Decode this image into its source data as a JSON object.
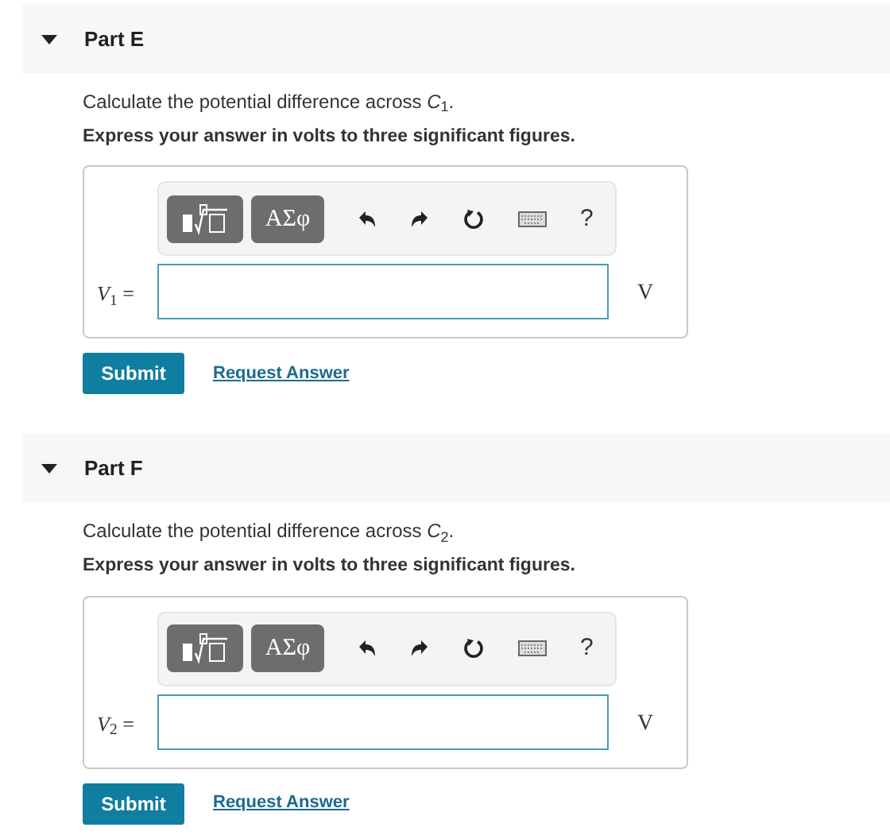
{
  "parts": [
    {
      "title": "Part E",
      "expanded": true,
      "prompt": "Calculate the potential difference across *C*$_{1}$.",
      "instruction": "Express your answer in volts to three significant figures.",
      "toolbar": {
        "templates": "ΑΣφ",
        "help": "?"
      },
      "answer": {
        "label": "*V*$_{1}$ =",
        "unit": "V"
      },
      "submit": "Submit",
      "request": "Request Answer"
    },
    {
      "title": "Part F",
      "expanded": true,
      "prompt": "Calculate the potential difference across *C*$_{2}$.",
      "instruction": "Express your answer in volts to three significant figures.",
      "toolbar": {
        "templates": "ΑΣφ",
        "help": "?"
      },
      "answer": {
        "label": "*V*$_{2}$ =",
        "unit": "V"
      },
      "submit": "Submit",
      "request": "Request Answer"
    }
  ]
}
